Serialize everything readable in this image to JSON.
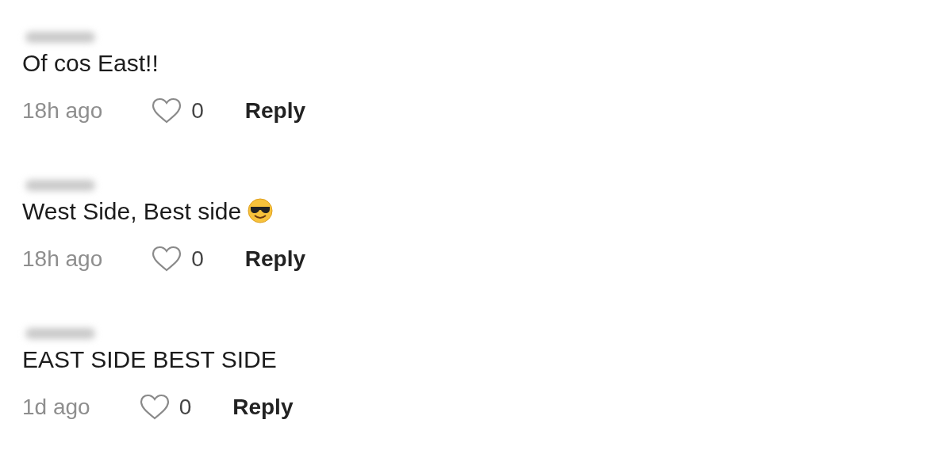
{
  "comments": [
    {
      "author_hidden": true,
      "text": "Of cos East!!",
      "time": "18h ago",
      "liked": false,
      "likes": "0",
      "reply": "Reply"
    },
    {
      "author_hidden": true,
      "text": "West Side, Best side",
      "sunglasses_emoji": true,
      "time": "18h ago",
      "liked": false,
      "likes": "0",
      "reply": "Reply"
    },
    {
      "author_hidden": true,
      "text": "EAST SIDE BEST SIDE",
      "time": "1d ago",
      "liked": false,
      "likes": "0",
      "reply": "Reply"
    }
  ]
}
